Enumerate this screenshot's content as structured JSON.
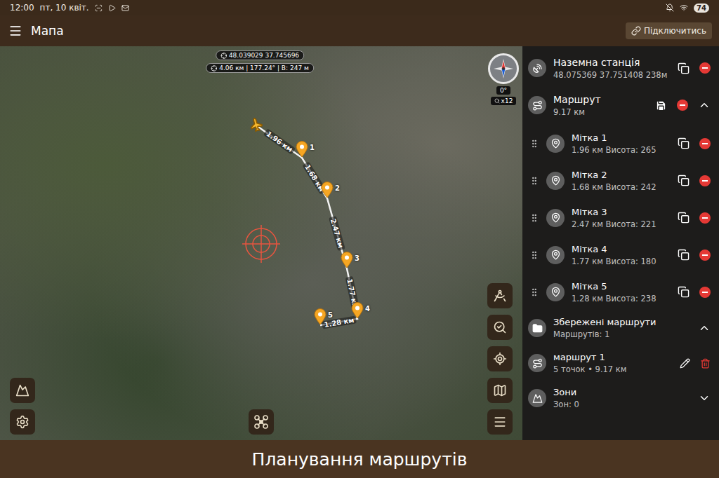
{
  "status_bar": {
    "time": "12:00",
    "date": "пт, 10 квіт.",
    "battery": "74"
  },
  "app_bar": {
    "title": "Мапа",
    "connect_button": "Підключитись"
  },
  "map": {
    "coordinates": "48.039029 37.745696",
    "measure": "4.06 км | 177.24° | В: 247 м",
    "compass": {
      "heading": "0°",
      "zoom": "x12"
    },
    "route_points": [
      {
        "label": "1"
      },
      {
        "label": "2"
      },
      {
        "label": "3"
      },
      {
        "label": "4"
      },
      {
        "label": "5"
      }
    ],
    "segments": [
      {
        "label": "1.96 км"
      },
      {
        "label": "1.68 км"
      },
      {
        "label": "2.47 км"
      },
      {
        "label": "1.77 км"
      },
      {
        "label": "1.28 км"
      }
    ]
  },
  "panel": {
    "ground_station": {
      "title": "Наземна станція",
      "subtitle": "48.075369 37.751408 238м"
    },
    "route": {
      "title": "Маршрут",
      "subtitle": "9.17 км",
      "expanded": true
    },
    "waypoints": [
      {
        "title": "Мітка 1",
        "subtitle": "1.96 км Висота: 265"
      },
      {
        "title": "Мітка 2",
        "subtitle": "1.68 км Висота: 242"
      },
      {
        "title": "Мітка 3",
        "subtitle": "2.47 км Висота: 221"
      },
      {
        "title": "Мітка 4",
        "subtitle": "1.77 км Висота: 180"
      },
      {
        "title": "Мітка 5",
        "subtitle": "1.28 км Висота: 238"
      }
    ],
    "saved_routes": {
      "title": "Збережені маршрути",
      "subtitle": "Маршрутів: 1",
      "expanded": true,
      "items": [
        {
          "title": "маршрут 1",
          "subtitle": "5 точок • 9.17 км"
        }
      ]
    },
    "zones": {
      "title": "Зони",
      "subtitle": "Зон: 0",
      "expanded": false
    }
  },
  "caption": "Планування маршрутів"
}
